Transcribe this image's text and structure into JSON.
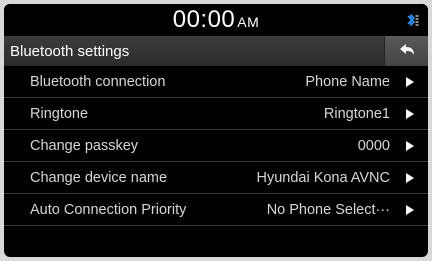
{
  "status": {
    "time": "00:00",
    "ampm": "AM",
    "bluetooth_icon": "bluetooth-icon"
  },
  "header": {
    "title": "Bluetooth settings",
    "back_icon": "back-arrow-icon"
  },
  "settings": [
    {
      "label": "Bluetooth connection",
      "value": "Phone Name"
    },
    {
      "label": "Ringtone",
      "value": "Ringtone1"
    },
    {
      "label": "Change passkey",
      "value": "0000"
    },
    {
      "label": "Change device name",
      "value": "Hyundai Kona AVNC"
    },
    {
      "label": "Auto Connection Priority",
      "value": "No Phone Select···"
    }
  ],
  "colors": {
    "background": "#000000",
    "header": "#333333",
    "bluetooth_accent": "#2f8fff"
  }
}
